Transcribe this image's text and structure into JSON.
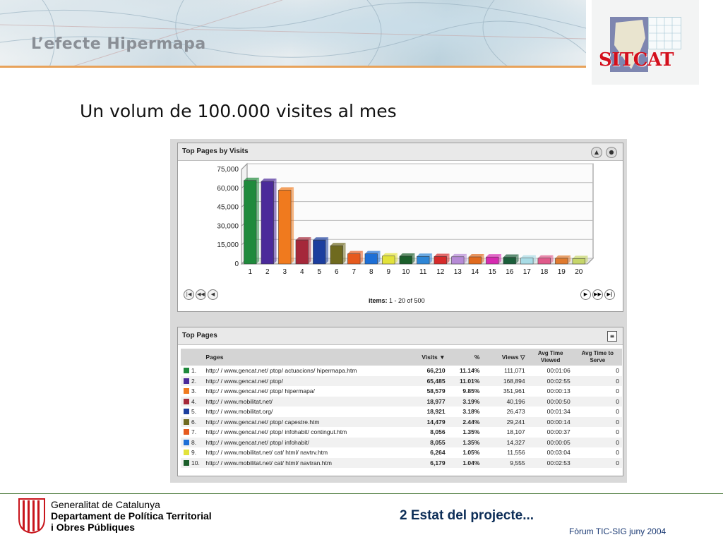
{
  "slide": {
    "title": "L’efecte Hipermapa",
    "logo_text": "SITCAT",
    "subtitle": "Un volum de 100.000 visites al mes",
    "section_footer": "2 Estat del projecte...",
    "forum_footer": "Fòrum TIC-SIG juny 2004"
  },
  "institution": {
    "line1": "Generalitat de Catalunya",
    "line2": "Departament de Política Territorial",
    "line3": "i Obres Públiques"
  },
  "top_visits_panel": {
    "title": "Top Pages by Visits",
    "items_label": "items:",
    "items_range": "1 - 20 of 500"
  },
  "chart_data": {
    "type": "bar",
    "title": "Top Pages by Visits",
    "categories": [
      "1",
      "2",
      "3",
      "4",
      "5",
      "6",
      "7",
      "8",
      "9",
      "10",
      "11",
      "12",
      "13",
      "14",
      "15",
      "16",
      "17",
      "18",
      "19",
      "20"
    ],
    "values": [
      66210,
      65485,
      58579,
      18977,
      18921,
      14479,
      8056,
      8055,
      6264,
      6179,
      6000,
      5900,
      5700,
      5600,
      5500,
      5300,
      4700,
      4600,
      4500,
      4300
    ],
    "colors": [
      "#1f8a3c",
      "#4b2a9a",
      "#f07a1e",
      "#a5283a",
      "#1c3e9e",
      "#6f6a1f",
      "#e65a1e",
      "#1d6fd6",
      "#e2e23a",
      "#1b5e2a",
      "#2e86d6",
      "#d62a2a",
      "#b68ad6",
      "#e06a1e",
      "#d62ab0",
      "#1b5e3a",
      "#a8dce6",
      "#e05a8a",
      "#e07a2e",
      "#c6d66a"
    ],
    "yticks": [
      "0",
      "15,000",
      "30,000",
      "45,000",
      "60,000",
      "75,000"
    ],
    "ylim": [
      0,
      75000
    ],
    "grid": true
  },
  "top_pages_panel": {
    "title": "Top Pages",
    "columns": [
      "Pages",
      "Visits ▼",
      "%",
      "Views ▽",
      "Avg Time Viewed",
      "Avg Time to Serve"
    ],
    "rows": [
      {
        "rank": "1.",
        "page": "http:/ / www.gencat.net/ ptop/ actuacions/ hipermapa.htm",
        "visits": "66,210",
        "pct": "11.14%",
        "views": "111,071",
        "avg_viewed": "00:01:06",
        "avg_serve": "0",
        "color": "#1f8a3c"
      },
      {
        "rank": "2.",
        "page": "http:/ / www.gencat.net/ ptop/",
        "visits": "65,485",
        "pct": "11.01%",
        "views": "168,894",
        "avg_viewed": "00:02:55",
        "avg_serve": "0",
        "color": "#4b2a9a"
      },
      {
        "rank": "3.",
        "page": "http:/ / www.gencat.net/ ptop/ hipermapa/",
        "visits": "58,579",
        "pct": "9.85%",
        "views": "351,961",
        "avg_viewed": "00:00:13",
        "avg_serve": "0",
        "color": "#f07a1e"
      },
      {
        "rank": "4.",
        "page": "http:/ / www.mobilitat.net/",
        "visits": "18,977",
        "pct": "3.19%",
        "views": "40,196",
        "avg_viewed": "00:00:50",
        "avg_serve": "0",
        "color": "#a5283a"
      },
      {
        "rank": "5.",
        "page": "http:/ / www.mobilitat.org/",
        "visits": "18,921",
        "pct": "3.18%",
        "views": "26,473",
        "avg_viewed": "00:01:34",
        "avg_serve": "0",
        "color": "#1c3e9e"
      },
      {
        "rank": "6.",
        "page": "http:/ / www.gencat.net/ ptop/ capestre.htm",
        "visits": "14,479",
        "pct": "2.44%",
        "views": "29,241",
        "avg_viewed": "00:00:14",
        "avg_serve": "0",
        "color": "#6f6a1f"
      },
      {
        "rank": "7.",
        "page": "http:/ / www.gencat.net/ ptop/ infohabit/ contingut.htm",
        "visits": "8,056",
        "pct": "1.35%",
        "views": "18,107",
        "avg_viewed": "00:00:37",
        "avg_serve": "0",
        "color": "#e65a1e"
      },
      {
        "rank": "8.",
        "page": "http:/ / www.gencat.net/ ptop/ infohabit/",
        "visits": "8,055",
        "pct": "1.35%",
        "views": "14,327",
        "avg_viewed": "00:00:05",
        "avg_serve": "0",
        "color": "#1d6fd6"
      },
      {
        "rank": "9.",
        "page": "http:/ / www.mobilitat.net/ cat/ html/ navtrv.htm",
        "visits": "6,264",
        "pct": "1.05%",
        "views": "11,556",
        "avg_viewed": "00:03:04",
        "avg_serve": "0",
        "color": "#e2e23a"
      },
      {
        "rank": "10.",
        "page": "http:/ / www.mobilitat.net/ cat/ html/ navtran.htm",
        "visits": "6,179",
        "pct": "1.04%",
        "views": "9,555",
        "avg_viewed": "00:02:53",
        "avg_serve": "0",
        "color": "#1b5e2a"
      }
    ]
  }
}
